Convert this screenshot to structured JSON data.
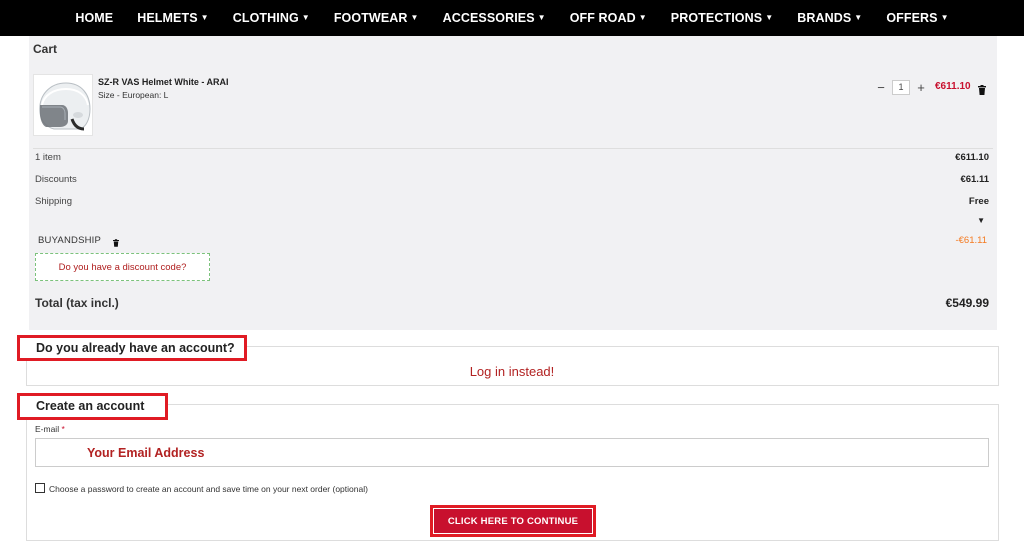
{
  "nav": {
    "items": [
      {
        "label": "HOME",
        "has_caret": false
      },
      {
        "label": "HELMETS",
        "has_caret": true
      },
      {
        "label": "CLOTHING",
        "has_caret": true
      },
      {
        "label": "FOOTWEAR",
        "has_caret": true
      },
      {
        "label": "ACCESSORIES",
        "has_caret": true
      },
      {
        "label": "OFF ROAD",
        "has_caret": true
      },
      {
        "label": "PROTECTIONS",
        "has_caret": true
      },
      {
        "label": "BRANDS",
        "has_caret": true
      },
      {
        "label": "OFFERS",
        "has_caret": true
      }
    ]
  },
  "cart": {
    "title": "Cart",
    "product": {
      "name": "SZ-R VAS Helmet White - ARAI",
      "attribute": "Size - European: L",
      "quantity": "1",
      "price": "€611.10"
    },
    "summary": {
      "items_label": "1 item",
      "items_value": "€611.10",
      "discounts_label": "Discounts",
      "discounts_value": "€61.11",
      "shipping_label": "Shipping",
      "shipping_value": "Free"
    },
    "voucher": {
      "name": "BUYANDSHIP",
      "value": "-€61.11"
    },
    "discount_code_prompt": "Do you have a discount code?",
    "total_label": "Total (tax incl.)",
    "total_value": "€549.99"
  },
  "account": {
    "heading": "Do you already have an account?",
    "login_link": "Log in instead!"
  },
  "create": {
    "heading": "Create an account",
    "email_label": "E-mail",
    "email_required": "*",
    "email_placeholder": "Your Email Address",
    "password_option": "Choose a password to create an account and save time on your next order (optional)",
    "continue_label": "CLICK HERE TO CONTINUE"
  },
  "colors": {
    "accent_red": "#c8102e",
    "highlight_border": "#e01b24",
    "discount_orange": "#f47a20",
    "nav_bg": "#000000"
  }
}
